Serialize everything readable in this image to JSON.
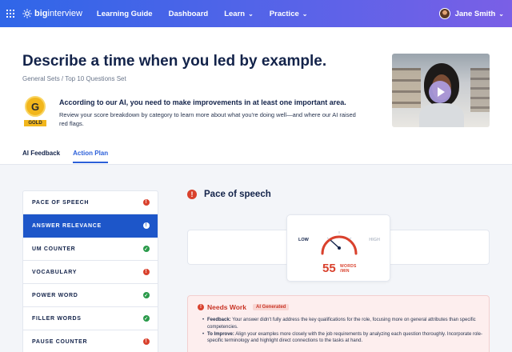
{
  "nav": {
    "logo_bold": "big",
    "logo_light": "interview",
    "links": [
      {
        "label": "Learning Guide",
        "has_caret": false
      },
      {
        "label": "Dashboard",
        "has_caret": false
      },
      {
        "label": "Learn",
        "has_caret": true
      },
      {
        "label": "Practice",
        "has_caret": true
      }
    ],
    "user_name": "Jane Smith"
  },
  "question": {
    "title": "Describe a time when you led by example.",
    "breadcrumb": "General Sets / Top 10 Questions Set"
  },
  "medal": {
    "letter": "G",
    "tag": "GOLD"
  },
  "ai_summary": {
    "title": "According to our AI, you need to make improvements in at least one important area.",
    "description": "Review your score breakdown by category to learn more about what you're doing well—and where our AI raised red flags."
  },
  "tabs": [
    {
      "label": "AI Feedback",
      "active": false
    },
    {
      "label": "Action Plan",
      "active": true
    }
  ],
  "sidebar": {
    "items": [
      {
        "label": "PACE OF SPEECH",
        "status": "red",
        "glyph": "!"
      },
      {
        "label": "ANSWER RELEVANCE",
        "status": "white",
        "glyph": "!",
        "active": true
      },
      {
        "label": "UM COUNTER",
        "status": "green",
        "glyph": "✓"
      },
      {
        "label": "VOCABULARY",
        "status": "red",
        "glyph": "!"
      },
      {
        "label": "POWER WORD",
        "status": "green",
        "glyph": "✓"
      },
      {
        "label": "FILLER WORDS",
        "status": "green",
        "glyph": "✓"
      },
      {
        "label": "PAUSE COUNTER",
        "status": "red",
        "glyph": "!"
      }
    ]
  },
  "section": {
    "title": "Pace of speech",
    "glyph": "!"
  },
  "gauge": {
    "low_label": "LOW",
    "high_label": "HIGH",
    "value": "55",
    "unit_line1": "WORDS",
    "unit_line2": "/MIN",
    "level": 0.3,
    "color": "#d9412d"
  },
  "needs_work": {
    "title": "Needs Work",
    "badge": "AI Generated",
    "feedback_label": "Feedback:",
    "feedback_text": " Your answer didn't fully address the key qualifications for the role, focusing more on general attributes than specific competencies.",
    "improve_label": "To Improve:",
    "improve_text": " Align your examples more closely with the job requirements by analyzing each question thoroughly. Incorporate role-specific terminology and highlight direct connections to the tasks at hand."
  },
  "colors": {
    "accent": "#2b5fd9",
    "danger": "#d9412d",
    "success": "#2a9a4a",
    "gold": "#f2b61c"
  }
}
